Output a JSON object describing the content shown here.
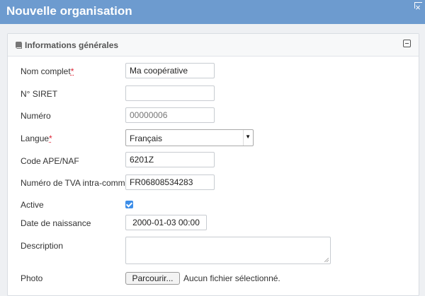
{
  "dialog": {
    "title": "Nouvelle organisation"
  },
  "panel": {
    "title": "Informations générales",
    "icon": "book-icon"
  },
  "fields": {
    "nom_complet": {
      "label": "Nom complet",
      "required_mark": "*",
      "value": "Ma coopérative"
    },
    "siret": {
      "label": "N° SIRET",
      "value": ""
    },
    "numero": {
      "label": "Numéro",
      "placeholder": "00000006"
    },
    "langue": {
      "label": "Langue",
      "required_mark": "*",
      "selected": "Français"
    },
    "code_ape": {
      "label": "Code APE/NAF",
      "value": "6201Z"
    },
    "tva": {
      "label": "Numéro de TVA intra-comm...",
      "value": "FR06808534283"
    },
    "active": {
      "label": "Active",
      "checked": true
    },
    "date_naissance": {
      "label": "Date de naissance",
      "value": "2000-01-03 00:00"
    },
    "description": {
      "label": "Description",
      "value": ""
    },
    "photo": {
      "label": "Photo",
      "button_label": "Parcourir...",
      "status": "Aucun fichier sélectionné."
    }
  },
  "colors": {
    "titlebar": "#6d9bcf",
    "checkbox": "#3d8ee8",
    "required": "#d23"
  }
}
